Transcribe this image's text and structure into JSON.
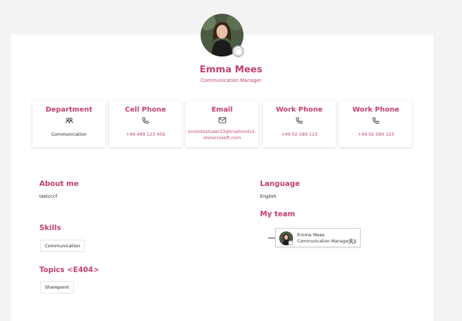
{
  "profile": {
    "name": "Emma Mees",
    "role": "Communication Manager"
  },
  "tiles": [
    {
      "title": "Department",
      "icon": "people-icon",
      "value": "Communication"
    },
    {
      "title": "Cell Phone",
      "icon": "phone-icon",
      "value": "+49 489 123 456"
    },
    {
      "title": "Email",
      "icon": "mail-icon",
      "value": "involvtestuser23@trialinvolv1.onmicrosoft.com"
    },
    {
      "title": "Work Phone",
      "icon": "phone-icon",
      "value": "+49 02 589 123"
    },
    {
      "title": "Work Phone",
      "icon": "phone-icon",
      "value": "+49 02 589 123"
    }
  ],
  "about": {
    "title": "About me",
    "text": "testcccf"
  },
  "skills": {
    "title": "Skills",
    "items": [
      "Communication"
    ]
  },
  "topics": {
    "title": "Topics <E404>",
    "items": [
      "Sharepoint"
    ]
  },
  "language": {
    "title": "Language",
    "text": "English"
  },
  "team": {
    "title": "My team",
    "member": {
      "name": "Emma Mees",
      "role": "Communication Manager",
      "icon": "org-chart-icon"
    }
  },
  "colors": {
    "accent": "#c2416a",
    "background": "#f3f3f4",
    "card": "#ffffff"
  }
}
